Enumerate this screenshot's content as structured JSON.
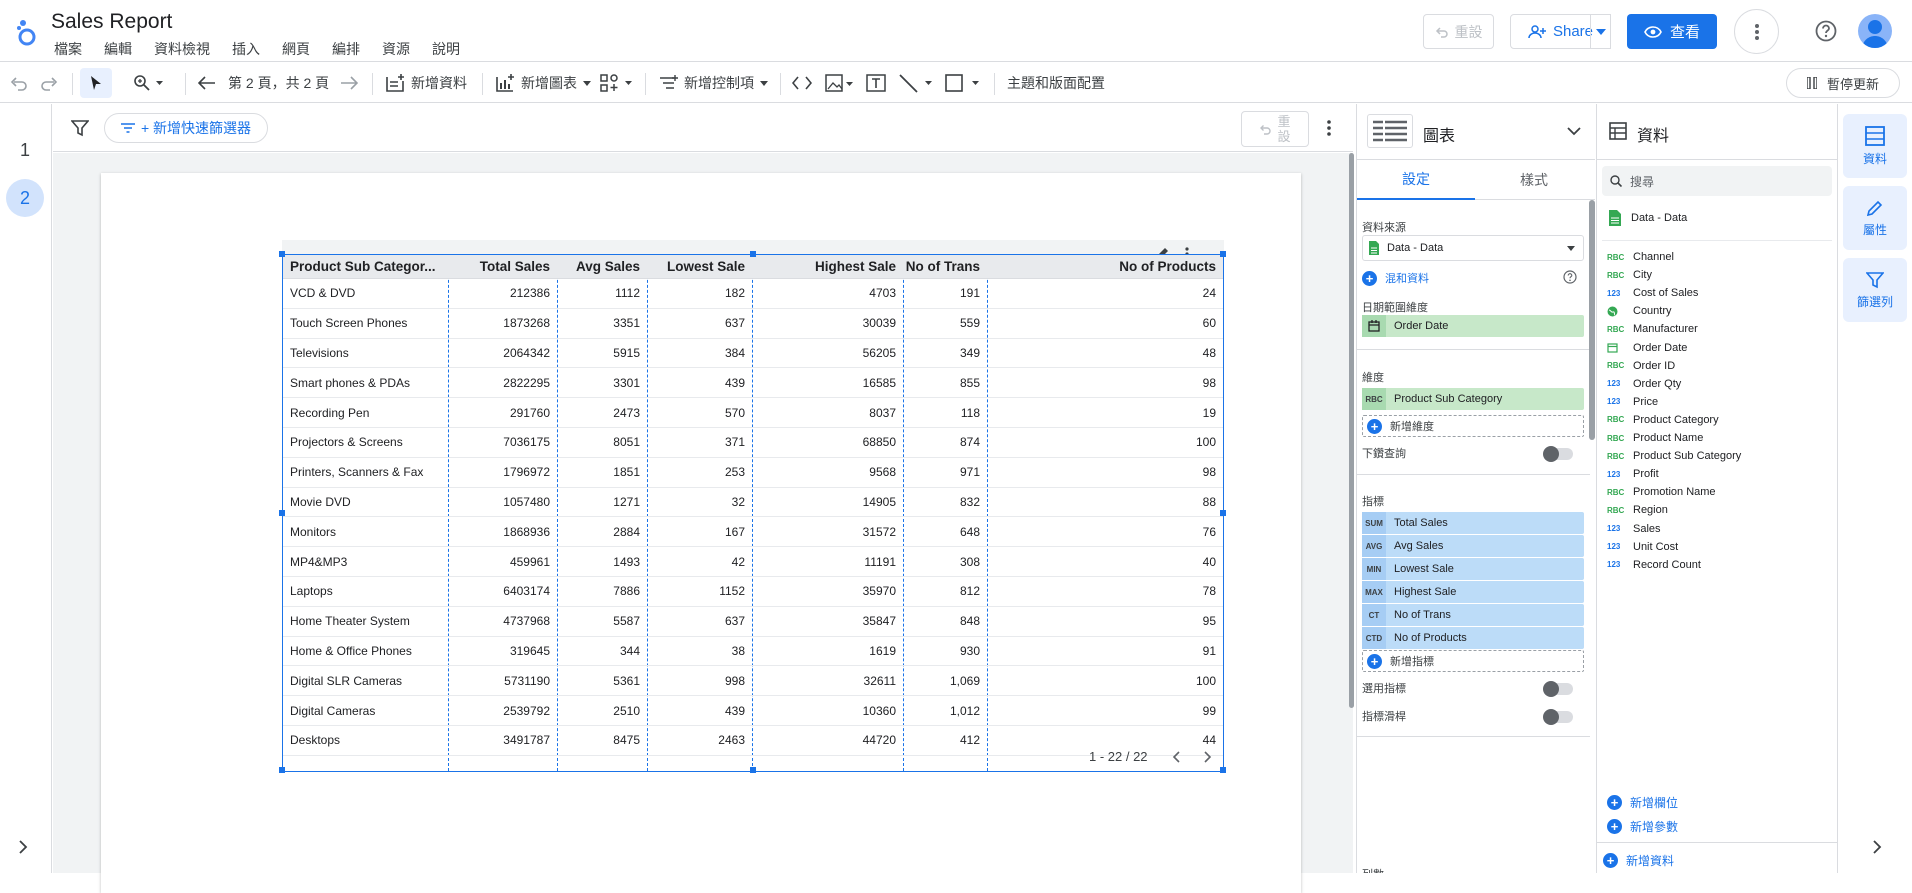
{
  "app": {
    "title": "Sales Report",
    "menu": [
      "檔案",
      "編輯",
      "資料檢視",
      "插入",
      "網頁",
      "編排",
      "資源",
      "說明"
    ],
    "reset_label": "重設",
    "share_label": "Share",
    "view_label": "查看"
  },
  "toolbar": {
    "page_nav": "第 2 頁，共 2 頁",
    "add_data": "新增資料",
    "add_chart": "新增圖表",
    "add_control": "新增控制項",
    "theme_layout": "主題和版面配置",
    "pause_update": "暫停更新"
  },
  "pages": [
    "1",
    "2"
  ],
  "filterbar": {
    "quick_filter": "+ 新增快速篩選器",
    "reset_label": "重設"
  },
  "table": {
    "headers": [
      "Product Sub Categor...",
      "Total Sales",
      "Avg Sales",
      "Lowest Sale",
      "Highest Sale",
      "No of Trans",
      "No of Products"
    ],
    "rows": [
      [
        "VCD & DVD",
        "212386",
        "1112",
        "182",
        "4703",
        "191",
        "24"
      ],
      [
        "Touch Screen Phones",
        "1873268",
        "3351",
        "637",
        "30039",
        "559",
        "60"
      ],
      [
        "Televisions",
        "2064342",
        "5915",
        "384",
        "56205",
        "349",
        "48"
      ],
      [
        "Smart phones & PDAs",
        "2822295",
        "3301",
        "439",
        "16585",
        "855",
        "98"
      ],
      [
        "Recording Pen",
        "291760",
        "2473",
        "570",
        "8037",
        "118",
        "19"
      ],
      [
        "Projectors & Screens",
        "7036175",
        "8051",
        "371",
        "68850",
        "874",
        "100"
      ],
      [
        "Printers, Scanners & Fax",
        "1796972",
        "1851",
        "253",
        "9568",
        "971",
        "98"
      ],
      [
        "Movie DVD",
        "1057480",
        "1271",
        "32",
        "14905",
        "832",
        "88"
      ],
      [
        "Monitors",
        "1868936",
        "2884",
        "167",
        "31572",
        "648",
        "76"
      ],
      [
        "MP4&MP3",
        "459961",
        "1493",
        "42",
        "11191",
        "308",
        "40"
      ],
      [
        "Laptops",
        "6403174",
        "7886",
        "1152",
        "35970",
        "812",
        "78"
      ],
      [
        "Home Theater System",
        "4737968",
        "5587",
        "637",
        "35847",
        "848",
        "95"
      ],
      [
        "Home & Office Phones",
        "319645",
        "344",
        "38",
        "1619",
        "930",
        "91"
      ],
      [
        "Digital SLR Cameras",
        "5731190",
        "5361",
        "998",
        "32611",
        "1,069",
        "100"
      ],
      [
        "Digital Cameras",
        "2539792",
        "2510",
        "439",
        "10360",
        "1,012",
        "99"
      ],
      [
        "Desktops",
        "3491787",
        "8475",
        "2463",
        "44720",
        "412",
        "44"
      ]
    ],
    "pagination": "1 - 22 / 22"
  },
  "chart_panel": {
    "title": "圖表",
    "tab_setup": "設定",
    "tab_style": "樣式",
    "data_source_label": "資料來源",
    "data_source": "Data - Data",
    "blend_data": "混和資料",
    "date_range_label": "日期範圍維度",
    "date_dimension": "Order Date",
    "dimension_label": "維度",
    "dimension": {
      "tag": "RBC",
      "name": "Product Sub Category"
    },
    "add_dimension": "新增維度",
    "drill_down": "下鑽查詢",
    "metric_label": "指標",
    "metrics": [
      {
        "tag": "SUM",
        "name": "Total Sales"
      },
      {
        "tag": "AVG",
        "name": "Avg Sales"
      },
      {
        "tag": "MIN",
        "name": "Lowest Sale"
      },
      {
        "tag": "MAX",
        "name": "Highest Sale"
      },
      {
        "tag": "CT",
        "name": "No of Trans"
      },
      {
        "tag": "CTD",
        "name": "No of Products"
      }
    ],
    "add_metric": "新增指標",
    "optional_metrics": "選用指標",
    "metric_slider": "指標滑桿",
    "bottom_cut": "列數"
  },
  "data_panel": {
    "title": "資料",
    "search_placeholder": "搜尋",
    "source": "Data - Data",
    "fields": [
      {
        "type": "RBC",
        "name": "Channel"
      },
      {
        "type": "RBC",
        "name": "City"
      },
      {
        "type": "123",
        "name": "Cost of Sales"
      },
      {
        "type": "geo",
        "name": "Country"
      },
      {
        "type": "RBC",
        "name": "Manufacturer"
      },
      {
        "type": "date",
        "name": "Order Date"
      },
      {
        "type": "RBC",
        "name": "Order ID"
      },
      {
        "type": "123",
        "name": "Order Qty"
      },
      {
        "type": "123",
        "name": "Price"
      },
      {
        "type": "RBC",
        "name": "Product Category"
      },
      {
        "type": "RBC",
        "name": "Product Name"
      },
      {
        "type": "RBC",
        "name": "Product Sub Category"
      },
      {
        "type": "123",
        "name": "Profit"
      },
      {
        "type": "RBC",
        "name": "Promotion Name"
      },
      {
        "type": "RBC",
        "name": "Region"
      },
      {
        "type": "123",
        "name": "Sales"
      },
      {
        "type": "123",
        "name": "Unit Cost"
      },
      {
        "type": "123",
        "name": "Record Count"
      }
    ],
    "add_field": "新增欄位",
    "add_parameter": "新增參數",
    "add_data": "新增資料"
  },
  "right_rail": {
    "data": "資料",
    "properties": "屬性",
    "filter": "篩選列"
  },
  "colors": {
    "accent": "#1a73e8",
    "dimension_chip": "#c7e8c9",
    "metric_chip": "#bcdcf8"
  }
}
